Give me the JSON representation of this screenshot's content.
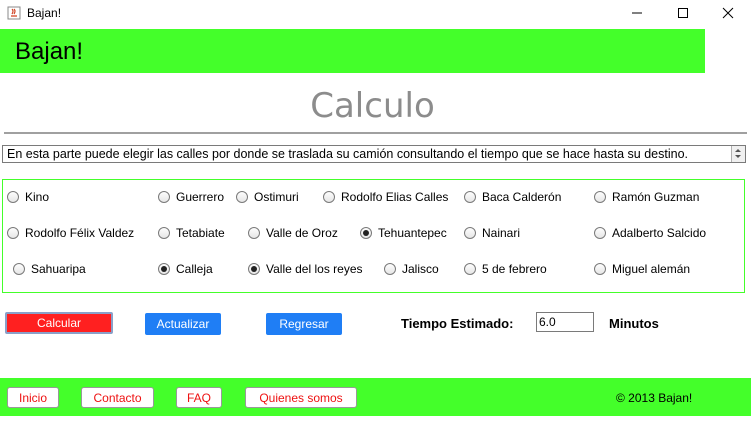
{
  "window": {
    "title": "Bajan!"
  },
  "header": {
    "title": "Bajan!"
  },
  "page": {
    "title": "Calculo"
  },
  "info": {
    "text": "En esta parte puede elegir las calles por donde se traslada su camión consultando el tiempo que se hace hasta su destino."
  },
  "streets": [
    {
      "label": "Kino",
      "selected": false
    },
    {
      "label": "Guerrero",
      "selected": false
    },
    {
      "label": "Ostimuri",
      "selected": false
    },
    {
      "label": "Rodolfo Elias Calles",
      "selected": false
    },
    {
      "label": "Baca Calderón",
      "selected": false
    },
    {
      "label": "Ramón Guzman",
      "selected": false
    },
    {
      "label": "Rodolfo Félix Valdez",
      "selected": false
    },
    {
      "label": "Tetabiate",
      "selected": false
    },
    {
      "label": "Valle de Oroz",
      "selected": false
    },
    {
      "label": "Tehuantepec",
      "selected": true
    },
    {
      "label": "Nainari",
      "selected": false
    },
    {
      "label": "Adalberto Salcido",
      "selected": false
    },
    {
      "label": "Sahuaripa",
      "selected": false
    },
    {
      "label": "Calleja",
      "selected": true
    },
    {
      "label": "Valle del los reyes",
      "selected": true
    },
    {
      "label": "Jalisco",
      "selected": false
    },
    {
      "label": "5 de febrero",
      "selected": false
    },
    {
      "label": "Miguel alemán",
      "selected": false
    }
  ],
  "actions": {
    "calcular": "Calcular",
    "actualizar": "Actualizar",
    "regresar": "Regresar"
  },
  "estimate": {
    "label": "Tiempo Estimado:",
    "value": "6.0",
    "unit": "Minutos"
  },
  "footer": {
    "links": [
      "Inicio",
      "Contacto",
      "FAQ",
      "Quienes somos"
    ],
    "copyright": "© 2013 Bajan!"
  },
  "colors": {
    "accent_green": "#44ff2a",
    "calc_red": "#ff2020",
    "button_blue": "#1f7ef5",
    "link_red": "#e11111"
  }
}
